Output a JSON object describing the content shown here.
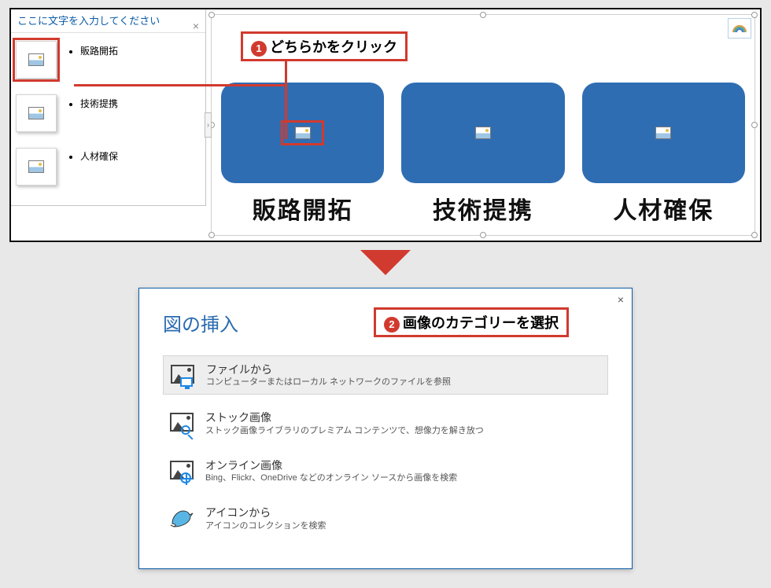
{
  "text_pane": {
    "header": "ここに文字を入力してください",
    "bullets": [
      "販路開拓",
      "技術提携",
      "人材確保"
    ]
  },
  "cards": [
    {
      "label": "販路開拓"
    },
    {
      "label": "技術提携"
    },
    {
      "label": "人材確保"
    }
  ],
  "callouts": {
    "one_num": "1",
    "one_text": "どちらかをクリック",
    "two_num": "2",
    "two_text": "画像のカテゴリーを選択"
  },
  "dialog": {
    "title": "図の挿入",
    "options": [
      {
        "title": "ファイルから",
        "desc": "コンピューターまたはローカル ネットワークのファイルを参照"
      },
      {
        "title": "ストック画像",
        "desc": "ストック画像ライブラリのプレミアム コンテンツで、想像力を解き放つ"
      },
      {
        "title": "オンライン画像",
        "desc": "Bing、Flickr、OneDrive などのオンライン ソースから画像を検索"
      },
      {
        "title": "アイコンから",
        "desc": "アイコンのコレクションを検索"
      }
    ]
  }
}
